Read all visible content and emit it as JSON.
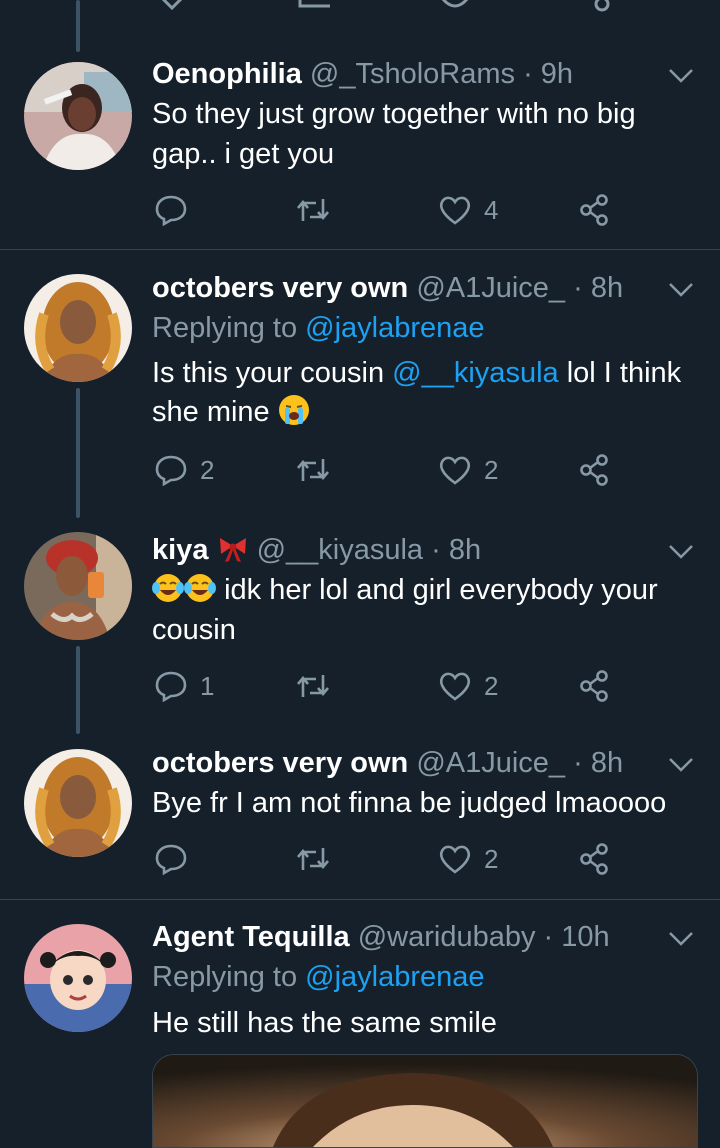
{
  "colors": {
    "bg": "#15202b",
    "accent": "#1da1f2",
    "muted": "#8899a6",
    "divider": "#38444d"
  },
  "tweets": [
    {
      "name": "Oenophilia",
      "handle": "@_TsholoRams",
      "time": "· 9h",
      "lines": [
        "So they just grow together with no big",
        "gap.. i get you"
      ],
      "replies": "",
      "retweets": "",
      "likes": "4",
      "avatar_icon": "avatar-photo"
    },
    {
      "name": "octobers very own",
      "handle": "@A1Juice_",
      "time": "· 8h",
      "replying_prefix": "Replying to",
      "replying_to": "@jaylabrenae",
      "line1_a": "Is this your cousin",
      "line1_mention": "@__kiyasula",
      "line1_b": "lol I think",
      "line2": "she mine",
      "emoji": "loudly-crying-face-emoji",
      "replies": "2",
      "retweets": "",
      "likes": "2"
    },
    {
      "name": "kiya",
      "name_emoji": "ribbon-emoji",
      "handle": "@__kiyasula",
      "time": "· 8h",
      "line1_emoji": "face-with-tears-of-joy-emoji",
      "line1": "idk her lol and girl everybody your",
      "line2": "cousin",
      "replies": "1",
      "retweets": "",
      "likes": "2"
    },
    {
      "name": "octobers very own",
      "handle": "@A1Juice_",
      "time": "· 8h",
      "line1": "Bye fr I am not finna be judged lmaoooo",
      "replies": "",
      "retweets": "",
      "likes": "2"
    },
    {
      "name": "Agent Tequilla",
      "handle": "@waridubaby",
      "time": "· 10h",
      "replying_prefix": "Replying to",
      "replying_to": "@jaylabrenae",
      "line1": "He still has the same smile"
    }
  ]
}
